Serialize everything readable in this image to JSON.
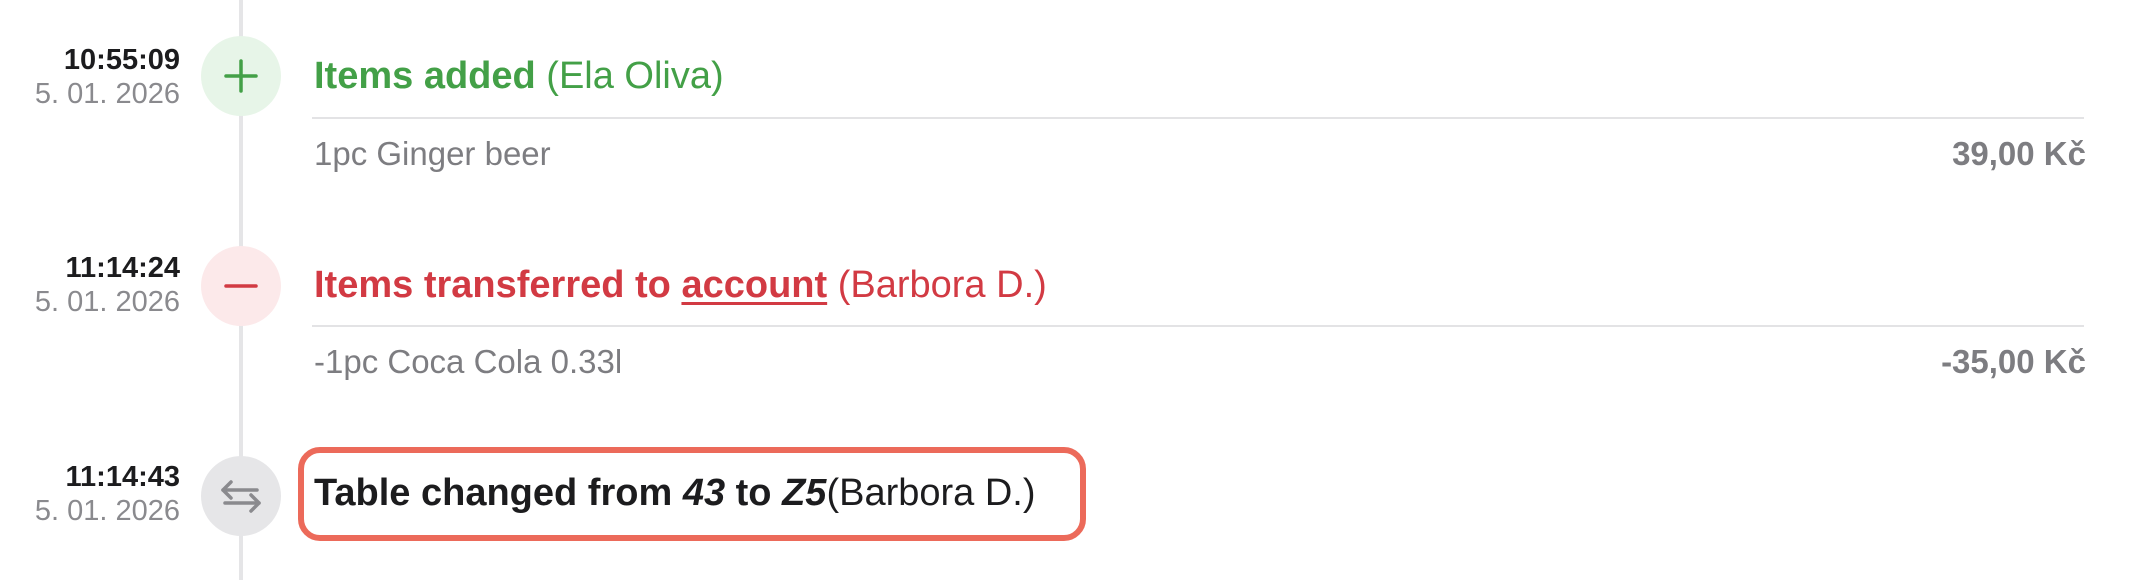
{
  "events": [
    {
      "time": "10:55:09",
      "date": "5. 01. 2026",
      "icon": "plus-icon",
      "color": "#43a047",
      "title_action": "Items added",
      "title_user": "(Ela Oliva)",
      "item_name": "1pc Ginger beer",
      "item_price": "39,00 Kč"
    },
    {
      "time": "11:14:24",
      "date": "5. 01. 2026",
      "icon": "minus-icon",
      "color": "#d23a43",
      "title_action": "Items transferred to",
      "title_link": "account",
      "title_user": "(Barbora D.)",
      "item_name": "-1pc Coca Cola 0.33l",
      "item_price": "-35,00 Kč"
    },
    {
      "time": "11:14:43",
      "date": "5. 01. 2026",
      "icon": "swap-arrows-icon",
      "color": "#1c1c1e",
      "title_action": "Table changed from",
      "from_table": "43",
      "to_word": "to",
      "to_table": "Z5",
      "title_user": "(Barbora D.)",
      "highlight_color": "#ec6a5a"
    }
  ]
}
